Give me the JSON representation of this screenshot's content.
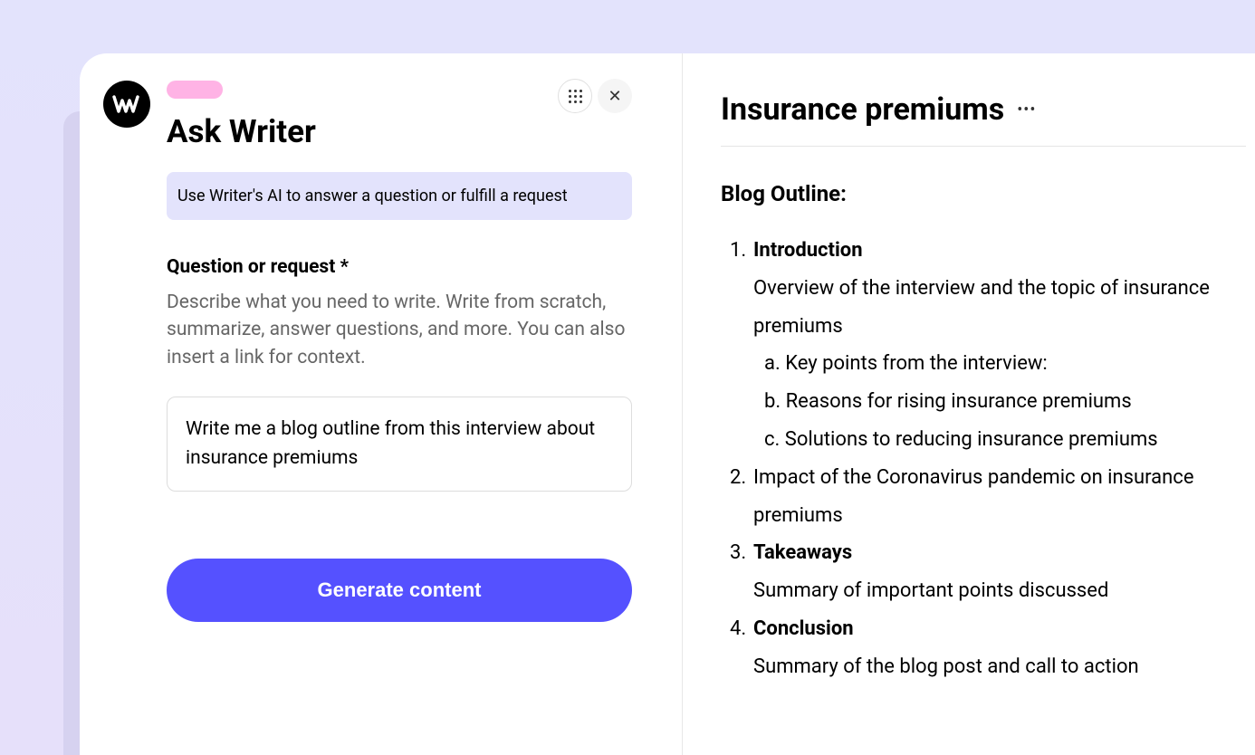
{
  "header": {
    "title": "Ask Writer",
    "info_text": "Use Writer's AI to answer a question or fulfill a request"
  },
  "form": {
    "field_label": "Question or request *",
    "field_description": "Describe what you need to write. Write from scratch, summarize, answer questions, and more. You can also insert a link for context.",
    "input_value": "Write me a blog outline from this interview about insurance premiums",
    "button_label": "Generate content"
  },
  "document": {
    "title": "Insurance premiums",
    "outline_title": "Blog Outline:",
    "items": [
      {
        "heading": "Introduction",
        "body": "Overview of the interview and the topic of insurance premiums",
        "sub": [
          "a. Key points from the interview:",
          "b. Reasons for rising insurance premiums",
          "c. Solutions to reducing insurance premiums"
        ]
      },
      {
        "body_only": "Impact of the Coronavirus pandemic on insurance premiums"
      },
      {
        "heading": "Takeaways",
        "body": "Summary of important points discussed"
      },
      {
        "heading": "Conclusion",
        "body": "Summary of the blog post and call to action"
      }
    ]
  }
}
